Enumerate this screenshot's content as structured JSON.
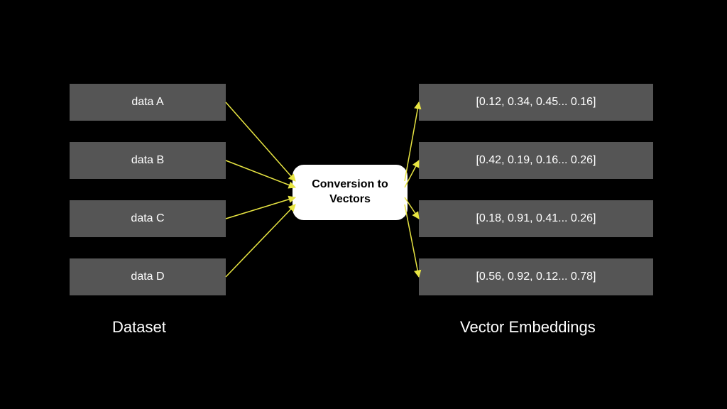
{
  "left_label": "Dataset",
  "right_label": "Vector Embeddings",
  "converter_label": "Conversion to Vectors",
  "inputs": [
    {
      "label": "data A"
    },
    {
      "label": "data B"
    },
    {
      "label": "data C"
    },
    {
      "label": "data D"
    }
  ],
  "outputs": [
    {
      "label": "[0.12, 0.34, 0.45... 0.16]"
    },
    {
      "label": "[0.42, 0.19, 0.16... 0.26]"
    },
    {
      "label": "[0.18, 0.91, 0.41... 0.26]"
    },
    {
      "label": "[0.56, 0.92, 0.12... 0.78]"
    }
  ],
  "colors": {
    "arrow": "#e8e542",
    "box_bg": "#555555",
    "converter_bg": "#ffffff"
  }
}
